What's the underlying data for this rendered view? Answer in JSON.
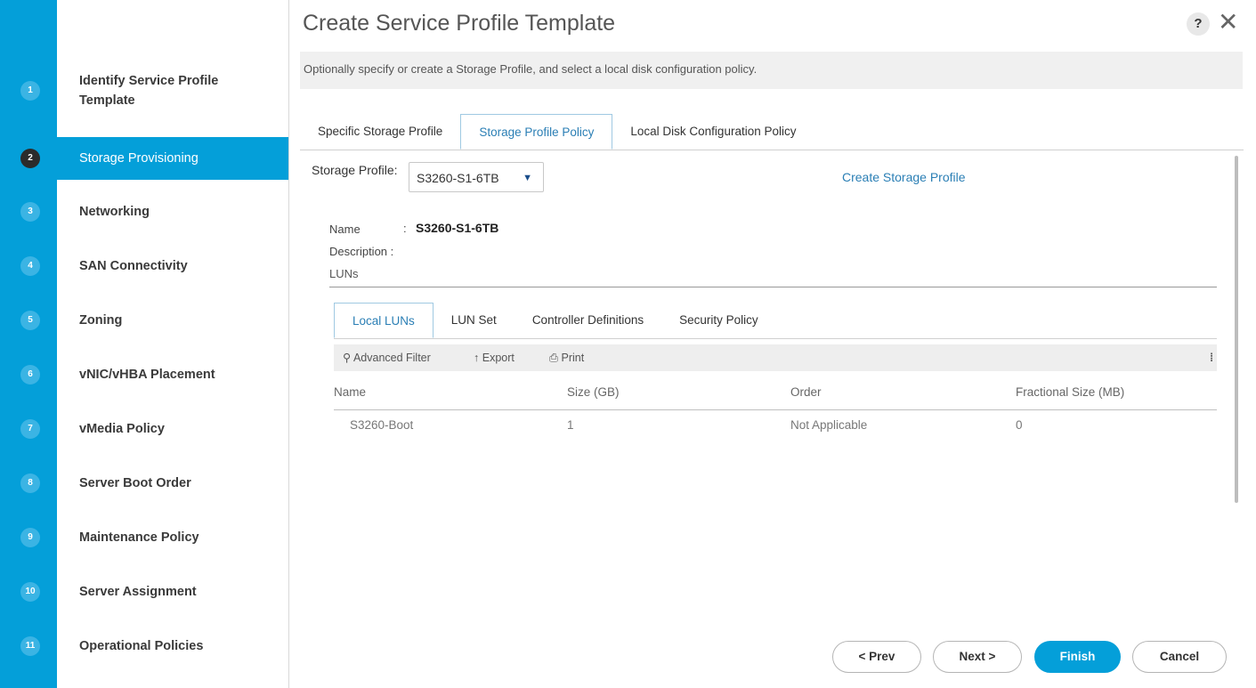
{
  "sidebar": {
    "steps": [
      {
        "num": "1",
        "label": "Identify Service Profile Template"
      },
      {
        "num": "2",
        "label": "Storage Provisioning"
      },
      {
        "num": "3",
        "label": "Networking"
      },
      {
        "num": "4",
        "label": "SAN Connectivity"
      },
      {
        "num": "5",
        "label": "Zoning"
      },
      {
        "num": "6",
        "label": "vNIC/vHBA Placement"
      },
      {
        "num": "7",
        "label": "vMedia Policy"
      },
      {
        "num": "8",
        "label": "Server Boot Order"
      },
      {
        "num": "9",
        "label": "Maintenance Policy"
      },
      {
        "num": "10",
        "label": "Server Assignment"
      },
      {
        "num": "11",
        "label": "Operational Policies"
      }
    ],
    "active_step": "2"
  },
  "header": {
    "title": "Create Service Profile Template",
    "help_icon": "?",
    "close_icon": "✕",
    "description": "Optionally specify or create a Storage Profile, and select a local disk configuration policy."
  },
  "top_tabs": [
    "Specific Storage Profile",
    "Storage Profile Policy",
    "Local Disk Configuration Policy"
  ],
  "active_top_tab": "Storage Profile Policy",
  "storage_profile": {
    "label": "Storage Profile:",
    "selected": "S3260-S1-6TB",
    "create_link": "Create Storage Profile"
  },
  "profile_details": {
    "name_label": "Name",
    "name_sep": ":",
    "name_value": "S3260-S1-6TB",
    "description_label": "Description :",
    "luns_label": "LUNs"
  },
  "inner_tabs": [
    "Local LUNs",
    "LUN Set",
    "Controller Definitions",
    "Security Policy"
  ],
  "active_inner_tab": "Local LUNs",
  "toolbar": {
    "filter": "Advanced Filter",
    "export": "Export",
    "print": "Print"
  },
  "table": {
    "columns": [
      "Name",
      "Size (GB)",
      "Order",
      "Fractional Size (MB)"
    ],
    "rows": [
      [
        "S3260-Boot",
        "1",
        "Not Applicable",
        "0"
      ]
    ]
  },
  "buttons": {
    "prev": "< Prev",
    "next": "Next >",
    "finish": "Finish",
    "cancel": "Cancel"
  },
  "colors": {
    "accent": "#049fd9",
    "link": "#2b7fb5"
  }
}
